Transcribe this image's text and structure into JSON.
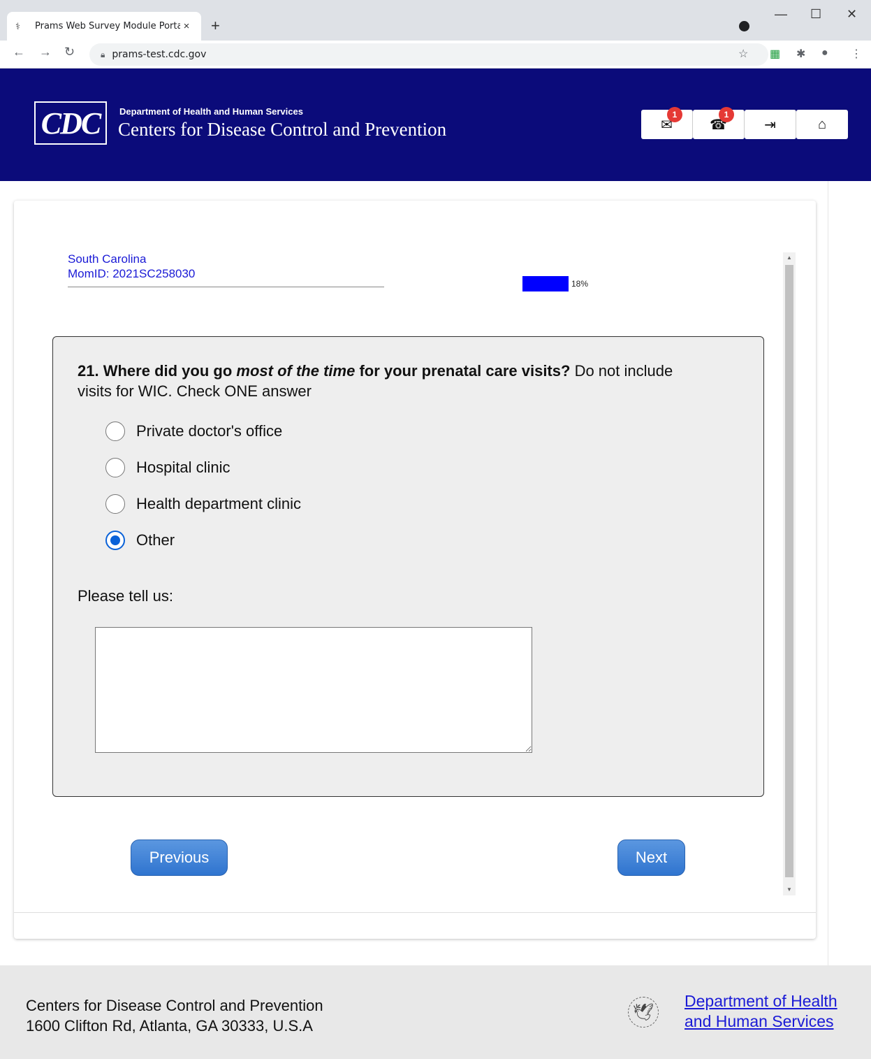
{
  "browser": {
    "tab_title": "Prams Web Survey Module Porta",
    "tab_close": "×",
    "new_tab": "+",
    "url": "prams-test.cdc.gov",
    "window_controls": {
      "minimize": "—",
      "maximize": "☐",
      "close": "✕"
    }
  },
  "header": {
    "logo_text": "CDC",
    "department": "Department of Health and Human Services",
    "agency": "Centers for Disease Control and Prevention",
    "buttons": [
      {
        "name": "messages",
        "icon": "envelope-icon",
        "glyph": "✉",
        "badge": "1"
      },
      {
        "name": "phone",
        "icon": "phone-icon",
        "glyph": "☎",
        "badge": "1"
      },
      {
        "name": "logout",
        "icon": "logout-icon",
        "glyph": "⇥",
        "badge": ""
      },
      {
        "name": "home",
        "icon": "home-icon",
        "glyph": "⌂",
        "badge": ""
      }
    ]
  },
  "respondent": {
    "state": "South Carolina",
    "mom_id": "MomID: 2021SC258030"
  },
  "progress": {
    "percent": 18,
    "label": "18%"
  },
  "question": {
    "number": "21.",
    "bold_pre": "Where did you go",
    "bold_italic": "most of the time",
    "bold_post": "for your prenatal care visits?",
    "instruction": "Do not include visits for WIC. Check ONE answer",
    "options": [
      {
        "label": "Private doctor's office",
        "checked": false
      },
      {
        "label": "Hospital clinic",
        "checked": false
      },
      {
        "label": "Health department clinic",
        "checked": false
      },
      {
        "label": "Other",
        "checked": true
      }
    ],
    "follow_up_label": "Please tell us:",
    "follow_up_value": ""
  },
  "nav": {
    "previous": "Previous",
    "next": "Next"
  },
  "footer": {
    "org": "Centers for Disease Control and Prevention",
    "address": "1600 Clifton Rd, Atlanta, GA 30333, U.S.A",
    "hhs_link_line1": "Department of Health",
    "hhs_link_line2": "and Human Services"
  },
  "colors": {
    "header_bg": "#0b0b7a",
    "link": "#1a1ad6",
    "progress": "#0000ff",
    "button": "#2f74cf",
    "badge": "#e53935"
  }
}
